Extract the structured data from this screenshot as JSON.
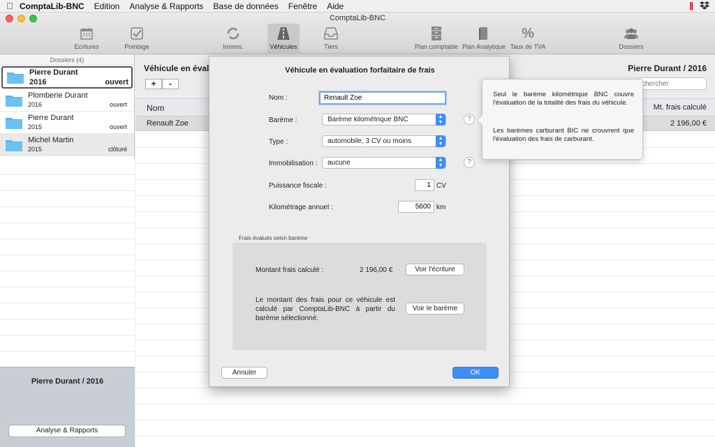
{
  "menubar": {
    "app": "ComptaLib-BNC",
    "items": [
      "Edition",
      "Analyse & Rapports",
      "Base de données",
      "Fenêtre",
      "Aide"
    ]
  },
  "window": {
    "title": "ComptaLib-BNC"
  },
  "toolbar": {
    "items": [
      {
        "label": "Ecritures",
        "icon": "calendar-icon"
      },
      {
        "label": "Pointage",
        "icon": "checkbox-icon"
      },
      {
        "label": "Immos.",
        "icon": "refresh-icon"
      },
      {
        "label": "Véhicules",
        "icon": "road-icon"
      },
      {
        "label": "Tiers",
        "icon": "inbox-icon"
      },
      {
        "label": "Plan comptable",
        "icon": "cabinet-icon"
      },
      {
        "label": "Plan Analytique",
        "icon": "book-icon"
      },
      {
        "label": "Taux de TVA",
        "icon": "percent-icon"
      },
      {
        "label": "Dossiers",
        "icon": "people-icon"
      }
    ],
    "active": "Véhicules"
  },
  "sidebar": {
    "header": "Dossiers (4)",
    "folders": [
      {
        "name": "Pierre Durant",
        "year": "2016",
        "status": "ouvert"
      },
      {
        "name": "Plomberie Durant",
        "year": "2016",
        "status": "ouvert"
      },
      {
        "name": "Pierre Durant",
        "year": "2015",
        "status": "ouvert"
      },
      {
        "name": "Michel Martin",
        "year": "2015",
        "status": "clôturé"
      }
    ],
    "current_dossier": "Pierre Durant / 2016",
    "analyse_button": "Analyse & Rapports"
  },
  "main": {
    "title": "Véhicule en évalu",
    "right_title": "Pierre Durant / 2016",
    "add_label": "+",
    "remove_label": "-",
    "search_placeholder": "chercher",
    "columns": [
      "Nom",
      "Mt. frais calculé"
    ],
    "rows": [
      {
        "nom": "Renault Zoe",
        "montant": "2 196,00 €"
      }
    ]
  },
  "dialog": {
    "title": "Véhicule en évaluation forfaitaire de frais",
    "nom_label": "Nom :",
    "nom_value": "Renault Zoe",
    "bareme_label": "Barème :",
    "bareme_value": "Barème kilométrique BNC",
    "type_label": "Type :",
    "type_value": "automobile, 3 CV ou moins",
    "immo_label": "Immobilisation :",
    "immo_value": "aucune",
    "puissance_label": "Puissance fiscale :",
    "puissance_value": "1",
    "puissance_unit": "CV",
    "km_label": "Kilométrage annuel :",
    "km_value": "5600",
    "km_unit": "km",
    "group_label": "Frais évalués selon barème",
    "montant_label": "Montant frais calculé :",
    "montant_value": "2 196,00 €",
    "voir_ecriture": "Voir l'écriture",
    "description": "Le montant des frais pour ce véhicule est calculé par ComptaLib-BNC à partir du barème sélectionné.",
    "voir_bareme": "Voir le barème",
    "cancel": "Annuler",
    "ok": "OK",
    "help_symbol": "?"
  },
  "popover": {
    "para1": "Seul le barème kilométrique BNC couvre l'évaluation de la totalité des frais du véhicule.",
    "para2": "Les barèmes carburant BIC ne crouvrent que l'évaluation des frais de carburant."
  },
  "colors": {
    "accent": "#3d8ef8",
    "sidebar_bottom": "#c9ced5"
  }
}
